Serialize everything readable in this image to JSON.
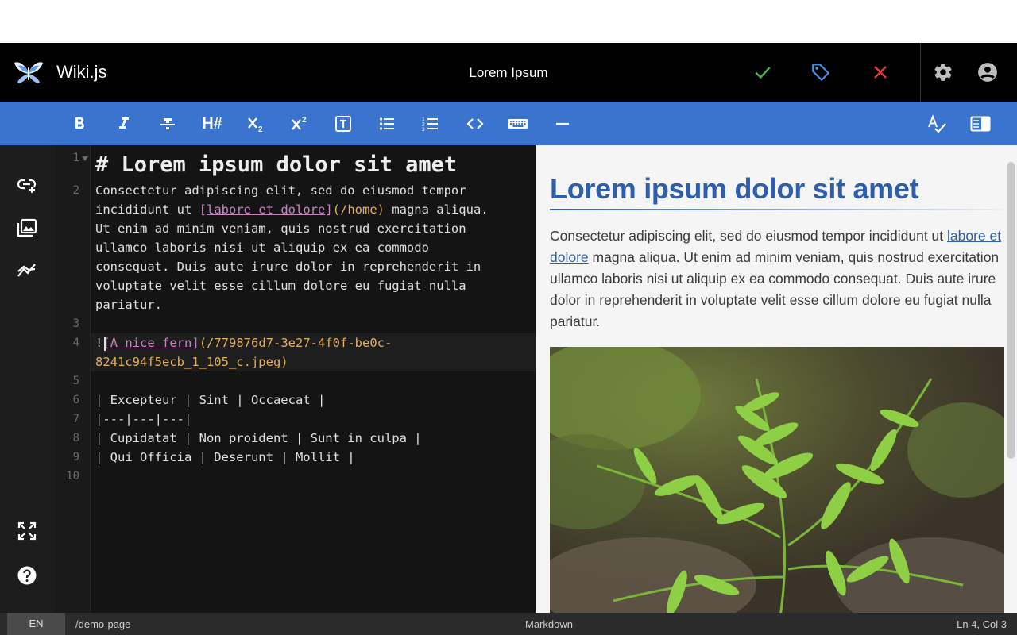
{
  "app": {
    "name": "Wiki.js",
    "page_title": "Lorem Ipsum"
  },
  "colors": {
    "accent": "#3a74cf",
    "save": "#4caf50",
    "tags": "#4a8fe8",
    "close": "#e53935"
  },
  "header_actions": [
    "check-icon",
    "tag-icon",
    "close-icon",
    "gear-icon",
    "account-icon"
  ],
  "toolbar": {
    "heading_label": "H#",
    "buttons": [
      "bold",
      "italic",
      "strikethrough",
      "heading",
      "subscript",
      "superscript",
      "blockquote",
      "bullet-list",
      "numbered-list",
      "inline-code",
      "keyboard",
      "horizontal-rule",
      "spellcheck",
      "toggle-preview"
    ]
  },
  "editor": {
    "line_numbers": [
      "1",
      "2",
      "3",
      "4",
      "5",
      "6",
      "7",
      "8",
      "9",
      "10"
    ],
    "line1": "# Lorem ipsum dolor sit amet",
    "line2a": "Consectetur adipiscing elit, sed do eiusmod tempor",
    "line2b_pre": "incididunt ut ",
    "line2b_link": "labore et dolore",
    "line2b_url": "(/home)",
    "line2b_post": " magna aliqua.",
    "line2c": "Ut enim ad minim veniam, quis nostrud exercitation",
    "line2d": "ullamco laboris nisi ut aliquip ex ea commodo",
    "line2e": "consequat. Duis aute irure dolor in reprehenderit in",
    "line2f": "voluptate velit esse cillum dolore eu fugiat nulla",
    "line2g": "pariatur.",
    "line4_bang": "!",
    "line4_alt": "A nice fern",
    "line4_url1": "(/779876d7-3e27-4f0f-be0c-",
    "line4_url2": "8241c94f5ecb_1_105_c.jpeg)",
    "line6": "| Excepteur | Sint | Occaecat |",
    "line7": "|---|---|---|",
    "line8": "| Cupidatat | Non proident | Sunt in culpa |",
    "line9": "| Qui Officia | Deserunt | Mollit |"
  },
  "preview": {
    "heading": "Lorem ipsum dolor sit amet",
    "para_pre": "Consectetur adipiscing elit, sed do eiusmod tempor incididunt ut ",
    "para_link": "labore et dolore",
    "para_post": " magna aliqua. Ut enim ad minim veniam, quis nostrud exercitation ullamco laboris nisi ut aliquip ex ea commodo consequat. Duis aute irure dolor in reprehenderit in voluptate velit esse cillum dolore eu fugiat nulla pariatur.",
    "image_alt": "A nice fern"
  },
  "sidenav": [
    "insert-link-icon",
    "insert-assets-icon",
    "insert-diagram-icon",
    "fullscreen-icon",
    "help-icon"
  ],
  "status": {
    "lang": "EN",
    "path": "/demo-page",
    "mode": "Markdown",
    "cursor": "Ln 4, Col 3"
  }
}
